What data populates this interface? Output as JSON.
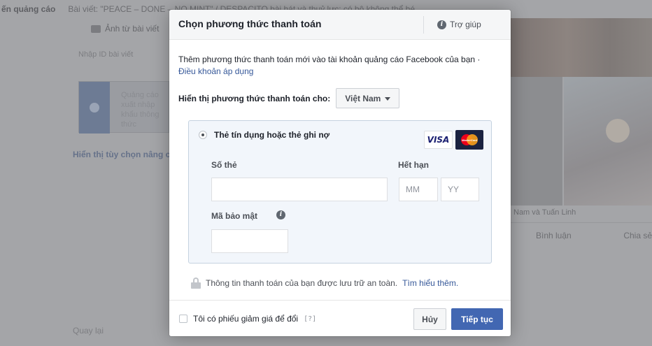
{
  "background": {
    "topbar_left": "ến quảng cáo",
    "topbar_right": "Bài viết: \"PEACE – DONE – NO MINT\" / DESPACITO bài hát và thuỷ lực: có bộ không thể bé",
    "photo_button": "Ảnh từ bài viết",
    "post_id_label": "Nhập ID bài viết",
    "card_text": "Quảng cáo xuất nhập khẩu thông thức",
    "advanced_link": "Hiển thị tùy chọn nâng cao",
    "bottom_left": "Quay lại",
    "right_caption": "Nam và Tuấn Linh",
    "right_action_comment": "Bình luận",
    "right_action_share": "Chia sẻ"
  },
  "modal": {
    "title": "Chọn phương thức thanh toán",
    "help_label": "Trợ giúp",
    "help_icon": "info-icon",
    "intro_text": "Thêm phương thức thanh toán mới vào tài khoản quảng cáo Facebook của bạn ·",
    "terms_link": "Điều khoản áp dụng",
    "country_label": "Hiển thị phương thức thanh toán cho:",
    "country_value": "Việt Nam",
    "payment_option_label": "Thẻ tín dụng hoặc thẻ ghi nợ",
    "visa_label": "VISA",
    "mastercard_label": "MasterCard",
    "card_number_label": "Số thẻ",
    "card_number_value": "",
    "expiry_label": "Hết hạn",
    "expiry_month_placeholder": "MM",
    "expiry_year_placeholder": "YY",
    "security_code_label": "Mã bảo mật",
    "security_code_value": "",
    "secure_text": "Thông tin thanh toán của bạn được lưu trữ an toàn.",
    "learn_more_link": "Tìm hiểu thêm.",
    "coupon_label": "Tôi có phiếu giảm giá để đổi",
    "coupon_help": "[?]",
    "cancel_button": "Hủy",
    "continue_button": "Tiếp tục"
  },
  "colors": {
    "primary_button": "#4267b2",
    "link": "#365899",
    "card_box_bg": "#f2f6fb",
    "card_box_border": "#c5d2e0",
    "overlay": "#a4a5a8"
  }
}
